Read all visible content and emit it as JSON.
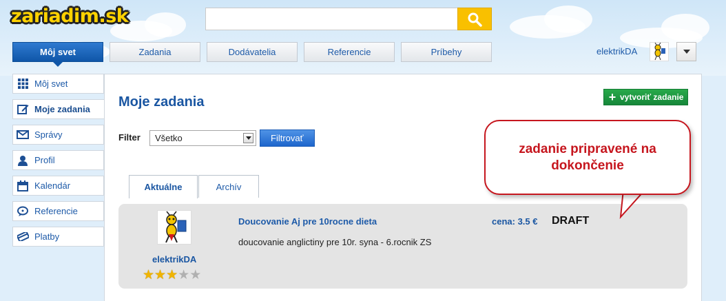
{
  "logo": {
    "text": "zariadim.sk"
  },
  "search": {
    "value": "",
    "placeholder": ""
  },
  "nav": {
    "tabs": [
      "Môj svet",
      "Zadania",
      "Dodávatelia",
      "Referencie",
      "Príbehy"
    ],
    "active": "Môj svet"
  },
  "user": {
    "name": "elektrikDA"
  },
  "sidebar": {
    "items": [
      {
        "label": "Môj svet",
        "icon": "grid-icon"
      },
      {
        "label": "Moje zadania",
        "icon": "edit-icon"
      },
      {
        "label": "Správy",
        "icon": "mail-icon"
      },
      {
        "label": "Profil",
        "icon": "person-icon"
      },
      {
        "label": "Kalendár",
        "icon": "calendar-icon"
      },
      {
        "label": "Referencie",
        "icon": "chat-icon"
      },
      {
        "label": "Platby",
        "icon": "card-icon"
      }
    ]
  },
  "main": {
    "title": "Moje zadania",
    "create_label": "vytvoriť zadanie",
    "filter": {
      "label": "Filter",
      "selected": "Všetko",
      "button": "Filtrovať"
    },
    "tabs": [
      "Aktuálne",
      "Archív"
    ],
    "task": {
      "user": "elektrikDA",
      "rating": 3,
      "rating_max": 5,
      "title": "Doucovanie Aj pre 10rocne dieta",
      "description": "doucovanie anglictiny pre 10r. syna - 6.rocnik ZS",
      "price": "cena: 3.5 €",
      "status": "DRAFT"
    }
  },
  "callout": {
    "text": "zadanie pripravené na dokončenie"
  },
  "colors": {
    "brand_blue": "#1a56a2",
    "search_yellow": "#f9c000",
    "create_green": "#1f9a41",
    "callout_red": "#c6161e",
    "star": "#f0b400"
  }
}
